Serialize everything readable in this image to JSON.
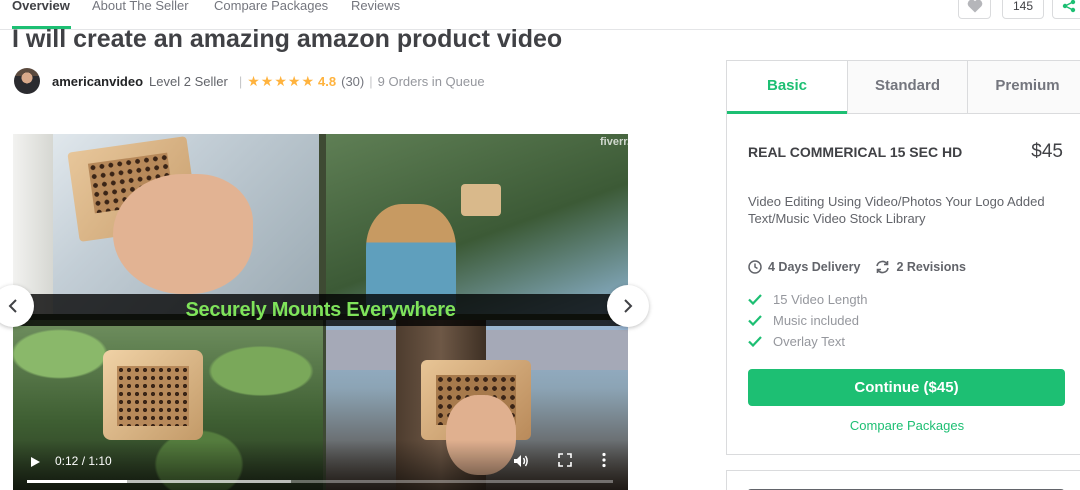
{
  "nav": {
    "tabs": [
      {
        "label": "Overview",
        "active": true
      },
      {
        "label": "About The Seller",
        "active": false
      },
      {
        "label": "Compare Packages",
        "active": false
      },
      {
        "label": "Reviews",
        "active": false
      }
    ],
    "like_count": "145",
    "accent_color": "#1dbf73"
  },
  "gig": {
    "title": "I will create an amazing amazon product video"
  },
  "seller": {
    "username": "americanvideo",
    "level": "Level 2 Seller",
    "separator": "|",
    "rating": "4.8",
    "star_count": 5,
    "reviews": "(30)",
    "queue": "9 Orders in Queue"
  },
  "video": {
    "caption": "Securely Mounts Everywhere",
    "watermark": "fiverr.",
    "time": "0:12 / 1:10",
    "progress_fraction": 0.17,
    "buffered_fraction": 0.45
  },
  "package": {
    "tabs": [
      {
        "label": "Basic",
        "active": true
      },
      {
        "label": "Standard",
        "active": false
      },
      {
        "label": "Premium",
        "active": false
      }
    ],
    "name": "REAL COMMERICAL 15 SEC HD",
    "price": "$45",
    "description": "Video Editing Using Video/Photos Your Logo Added Text/Music Video Stock Library",
    "delivery": "4 Days Delivery",
    "revisions": "2 Revisions",
    "features": [
      "15 Video Length",
      "Music included",
      "Overlay Text"
    ],
    "continue_label": "Continue ($45)",
    "compare_label": "Compare Packages"
  }
}
